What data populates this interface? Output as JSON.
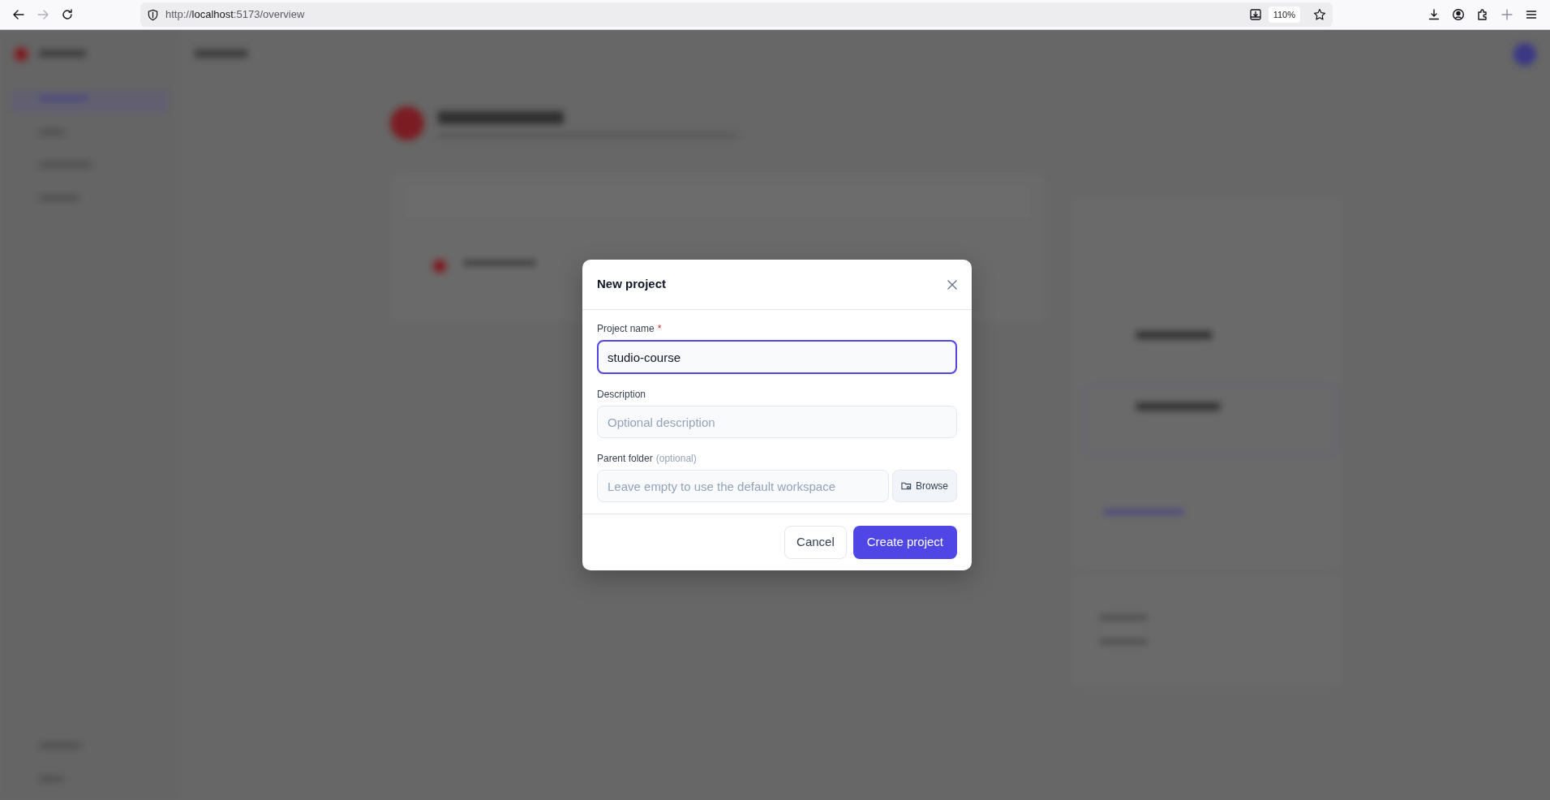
{
  "browser": {
    "url": "http://**localhost**:5173/overview",
    "zoom": "110%",
    "forward_disabled": true
  },
  "dialog": {
    "title": "New project",
    "fields": [
      {
        "kind": "text",
        "label": "Project name",
        "required_mark": "*",
        "value": "studio-course",
        "focused": true
      },
      {
        "kind": "text",
        "label": "Description",
        "placeholder": "Optional description",
        "focused": false
      },
      {
        "kind": "folder",
        "label": "Parent folder",
        "hint": "(optional)",
        "placeholder": "Leave empty to use the default workspace",
        "button": "Browse",
        "focused": false
      }
    ],
    "buttons": [
      {
        "label": "Cancel",
        "kind": "secondary"
      },
      {
        "label": "Create project",
        "kind": "primary"
      }
    ]
  }
}
